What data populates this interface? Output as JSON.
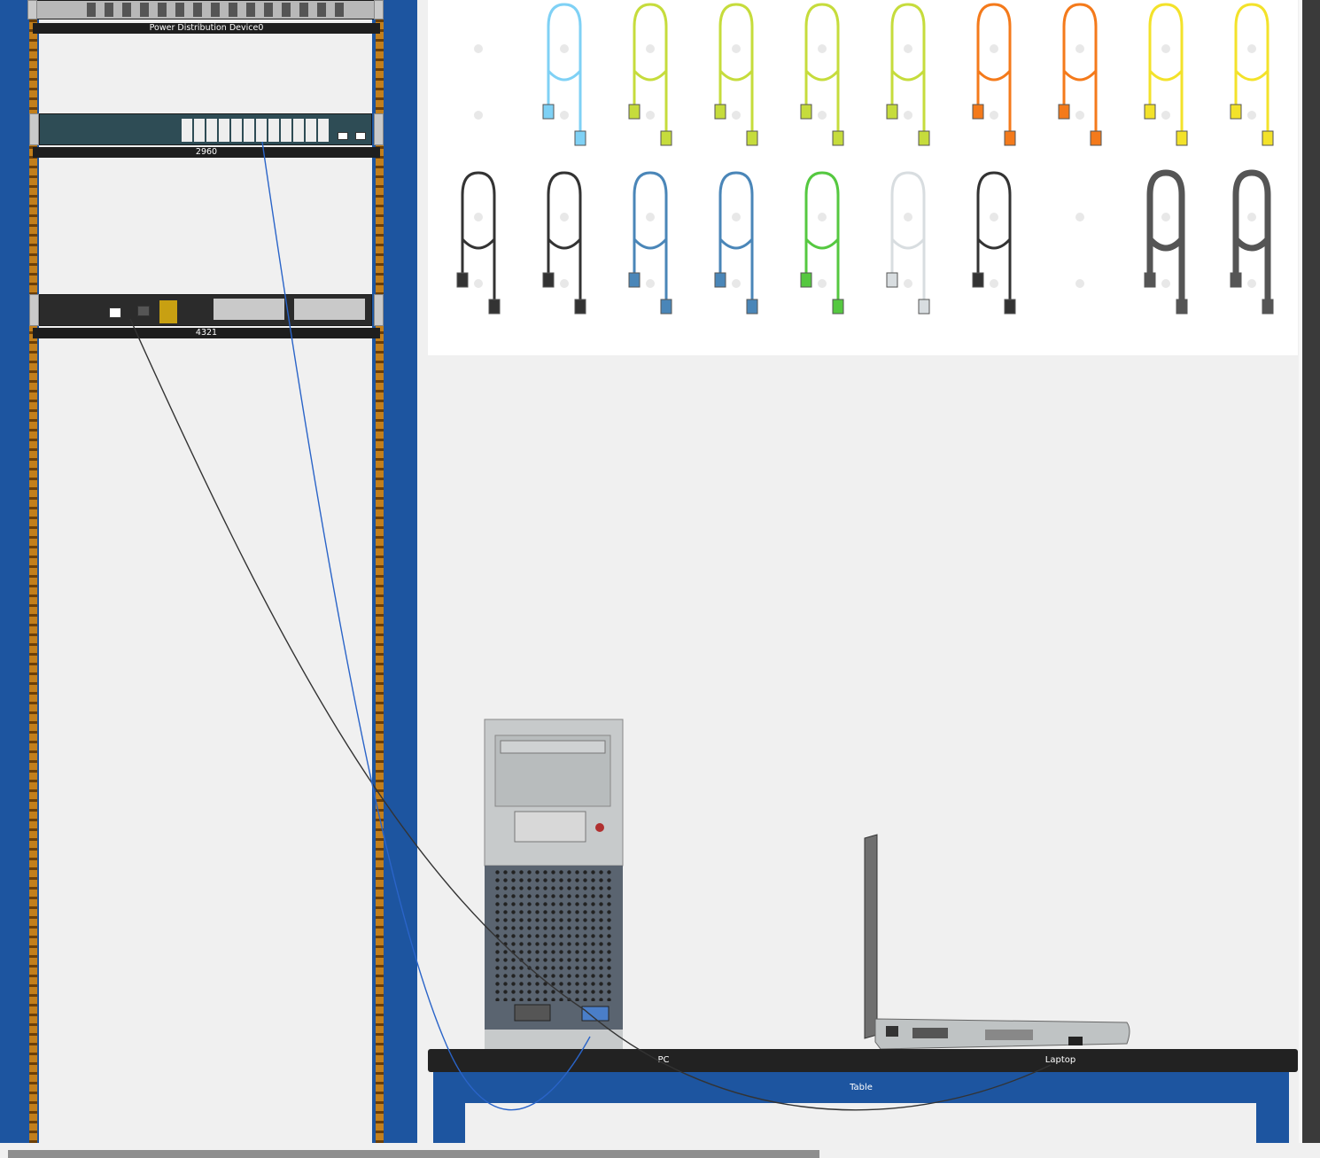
{
  "rack": {
    "devices": [
      {
        "name": "Power Distribution Device0"
      },
      {
        "name": "2960"
      },
      {
        "name": "4321"
      }
    ]
  },
  "table": {
    "label": "Table",
    "pc_label": "PC",
    "laptop_label": "Laptop"
  },
  "cable_shelf": {
    "row1": [
      {
        "icon": "empty-slot",
        "color": ""
      },
      {
        "icon": "ethernet-cable-icon",
        "color": "#7fd1f5"
      },
      {
        "icon": "ethernet-cable-icon",
        "color": "#c6dc3c"
      },
      {
        "icon": "ethernet-cable-icon",
        "color": "#c6dc3c"
      },
      {
        "icon": "ethernet-cable-icon",
        "color": "#c6dc3c"
      },
      {
        "icon": "ethernet-cable-icon",
        "color": "#c6dc3c"
      },
      {
        "icon": "ethernet-cable-icon",
        "color": "#f47a1b"
      },
      {
        "icon": "ethernet-cable-icon",
        "color": "#f47a1b"
      },
      {
        "icon": "fiber-cable-icon",
        "color": "#f3e22a"
      },
      {
        "icon": "fiber-cable-icon",
        "color": "#f3e22a"
      }
    ],
    "row2": [
      {
        "icon": "coaxial-cable-icon",
        "color": "#333333"
      },
      {
        "icon": "coaxial-cable-icon",
        "color": "#333333"
      },
      {
        "icon": "serial-cable-icon",
        "color": "#4a86b8"
      },
      {
        "icon": "serial-cable-icon",
        "color": "#4a86b8"
      },
      {
        "icon": "console-cable-icon",
        "color": "#55c840"
      },
      {
        "icon": "phone-cable-icon",
        "color": "#d8dde0"
      },
      {
        "icon": "usb-cable-icon",
        "color": "#333333"
      },
      {
        "icon": "empty-slot",
        "color": ""
      },
      {
        "icon": "power-cable-icon",
        "color": "#555555"
      },
      {
        "icon": "power-cable-icon",
        "color": "#555555"
      }
    ]
  },
  "colors": {
    "rack_blue": "#1d55a0",
    "cable_blue": "#2a64c8",
    "cable_black": "#333333"
  }
}
